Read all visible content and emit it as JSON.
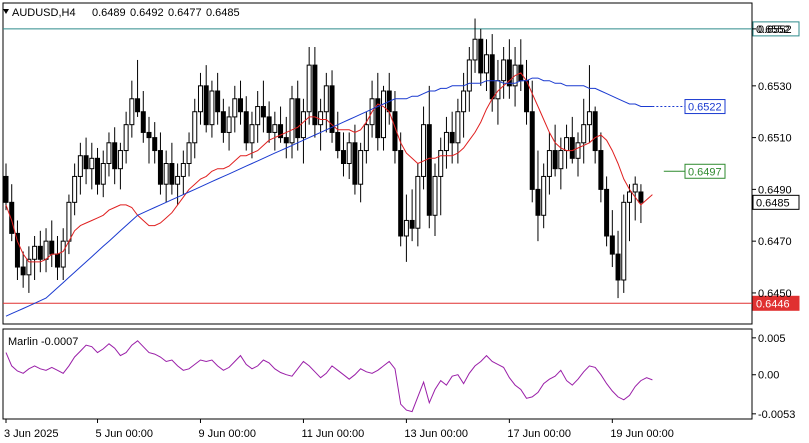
{
  "chart_data": {
    "type": "candlestick",
    "symbol_timeframe": "AUDUSD,H4",
    "ohlc_readout": [
      "0.6489",
      "0.6492",
      "0.6477",
      "0.6485"
    ],
    "ylim": [
      0.6438,
      0.6562
    ],
    "y_ticks": [
      "0.6552",
      "0.6530",
      "0.6510",
      "0.6490",
      "0.6470",
      "0.6450"
    ],
    "x_ticks": [
      "3 Jun 2025",
      "5 Jun 00:00",
      "9 Jun 00:00",
      "11 Jun 00:00",
      "13 Jun 00:00",
      "17 Jun 00:00",
      "19 Jun 00:00"
    ],
    "x_tick_index": [
      0,
      16,
      34,
      52,
      70,
      88,
      106
    ],
    "price_labels": [
      {
        "value": 0.6552,
        "text": "0.6552",
        "style": "teal-line"
      },
      {
        "value": 0.6522,
        "text": "0.6522",
        "style": "blue-box"
      },
      {
        "value": 0.6497,
        "text": "0.6497",
        "style": "green-box"
      },
      {
        "value": 0.6485,
        "text": "0.6485",
        "style": "current"
      },
      {
        "value": 0.6446,
        "text": "0.6446",
        "style": "red-line"
      }
    ],
    "level_lines": [
      {
        "value": 0.6552,
        "color": "#2e8b8b"
      },
      {
        "value": 0.6446,
        "color": "#e03030"
      }
    ],
    "resistance_level": {
      "value": 0.6497,
      "from_index": 115
    },
    "candles": [
      [
        0.6495,
        0.65,
        0.6482,
        0.6485
      ],
      [
        0.6485,
        0.6492,
        0.647,
        0.6473
      ],
      [
        0.6473,
        0.6478,
        0.6455,
        0.646
      ],
      [
        0.646,
        0.6466,
        0.6452,
        0.6457
      ],
      [
        0.6457,
        0.6468,
        0.645,
        0.6463
      ],
      [
        0.6463,
        0.6472,
        0.6455,
        0.6468
      ],
      [
        0.6468,
        0.6474,
        0.6458,
        0.6463
      ],
      [
        0.6463,
        0.6475,
        0.6458,
        0.647
      ],
      [
        0.647,
        0.6478,
        0.646,
        0.6465
      ],
      [
        0.6465,
        0.6472,
        0.6455,
        0.646
      ],
      [
        0.646,
        0.6475,
        0.6455,
        0.647
      ],
      [
        0.647,
        0.6488,
        0.6465,
        0.6485
      ],
      [
        0.6485,
        0.65,
        0.648,
        0.6495
      ],
      [
        0.6495,
        0.6508,
        0.6488,
        0.6503
      ],
      [
        0.6503,
        0.651,
        0.6492,
        0.6498
      ],
      [
        0.6498,
        0.6508,
        0.649,
        0.6502
      ],
      [
        0.6502,
        0.6506,
        0.6488,
        0.6492
      ],
      [
        0.6492,
        0.6505,
        0.6487,
        0.65
      ],
      [
        0.65,
        0.6512,
        0.6495,
        0.6508
      ],
      [
        0.6508,
        0.6514,
        0.6492,
        0.6498
      ],
      [
        0.6498,
        0.6508,
        0.649,
        0.6505
      ],
      [
        0.6505,
        0.652,
        0.65,
        0.6515
      ],
      [
        0.6515,
        0.6532,
        0.651,
        0.6525
      ],
      [
        0.6525,
        0.654,
        0.6518,
        0.652
      ],
      [
        0.652,
        0.6528,
        0.6508,
        0.6512
      ],
      [
        0.6512,
        0.6518,
        0.65,
        0.651
      ],
      [
        0.651,
        0.6516,
        0.65,
        0.6505
      ],
      [
        0.6505,
        0.6512,
        0.6488,
        0.6492
      ],
      [
        0.6492,
        0.6505,
        0.6485,
        0.65
      ],
      [
        0.65,
        0.6508,
        0.6488,
        0.6492
      ],
      [
        0.6492,
        0.65,
        0.6484,
        0.6495
      ],
      [
        0.6495,
        0.6505,
        0.6488,
        0.65
      ],
      [
        0.65,
        0.6512,
        0.6495,
        0.6508
      ],
      [
        0.6508,
        0.6525,
        0.6502,
        0.652
      ],
      [
        0.652,
        0.6535,
        0.6515,
        0.653
      ],
      [
        0.653,
        0.6538,
        0.6512,
        0.6515
      ],
      [
        0.6515,
        0.6532,
        0.651,
        0.6528
      ],
      [
        0.6528,
        0.6535,
        0.6515,
        0.652
      ],
      [
        0.652,
        0.6525,
        0.6508,
        0.6512
      ],
      [
        0.6512,
        0.6522,
        0.6505,
        0.6518
      ],
      [
        0.6518,
        0.653,
        0.6512,
        0.6525
      ],
      [
        0.6525,
        0.6532,
        0.6515,
        0.652
      ],
      [
        0.652,
        0.6526,
        0.6505,
        0.6508
      ],
      [
        0.6508,
        0.652,
        0.6502,
        0.6515
      ],
      [
        0.6515,
        0.6528,
        0.6508,
        0.6522
      ],
      [
        0.6522,
        0.6532,
        0.6512,
        0.6518
      ],
      [
        0.6518,
        0.6524,
        0.6508,
        0.6512
      ],
      [
        0.6512,
        0.652,
        0.6505,
        0.6515
      ],
      [
        0.6515,
        0.6522,
        0.6508,
        0.651
      ],
      [
        0.651,
        0.6518,
        0.6502,
        0.6508
      ],
      [
        0.6508,
        0.653,
        0.6502,
        0.6525
      ],
      [
        0.6525,
        0.6532,
        0.6505,
        0.651
      ],
      [
        0.651,
        0.6525,
        0.65,
        0.652
      ],
      [
        0.652,
        0.6545,
        0.6515,
        0.6538
      ],
      [
        0.6538,
        0.6545,
        0.651,
        0.6515
      ],
      [
        0.6515,
        0.6525,
        0.6505,
        0.652
      ],
      [
        0.652,
        0.6535,
        0.6512,
        0.653
      ],
      [
        0.653,
        0.6536,
        0.6508,
        0.6512
      ],
      [
        0.6512,
        0.652,
        0.6502,
        0.6505
      ],
      [
        0.6505,
        0.6512,
        0.6495,
        0.65
      ],
      [
        0.65,
        0.6512,
        0.6494,
        0.6508
      ],
      [
        0.6508,
        0.6515,
        0.6488,
        0.6492
      ],
      [
        0.6492,
        0.6508,
        0.6485,
        0.6505
      ],
      [
        0.6505,
        0.652,
        0.65,
        0.6515
      ],
      [
        0.6515,
        0.6532,
        0.651,
        0.6525
      ],
      [
        0.6525,
        0.6535,
        0.6505,
        0.651
      ],
      [
        0.651,
        0.653,
        0.6505,
        0.6528
      ],
      [
        0.6528,
        0.6535,
        0.6515,
        0.652
      ],
      [
        0.652,
        0.6528,
        0.65,
        0.6505
      ],
      [
        0.6505,
        0.6512,
        0.6468,
        0.6472
      ],
      [
        0.6472,
        0.6488,
        0.6462,
        0.6478
      ],
      [
        0.6478,
        0.649,
        0.647,
        0.6475
      ],
      [
        0.6475,
        0.65,
        0.6468,
        0.6495
      ],
      [
        0.6495,
        0.6522,
        0.649,
        0.6515
      ],
      [
        0.6515,
        0.653,
        0.6475,
        0.648
      ],
      [
        0.648,
        0.65,
        0.6472,
        0.6495
      ],
      [
        0.6495,
        0.651,
        0.648,
        0.6505
      ],
      [
        0.6505,
        0.6518,
        0.6498,
        0.6512
      ],
      [
        0.6512,
        0.652,
        0.65,
        0.6508
      ],
      [
        0.6508,
        0.6525,
        0.65,
        0.652
      ],
      [
        0.652,
        0.6535,
        0.651,
        0.6528
      ],
      [
        0.6528,
        0.6545,
        0.652,
        0.654
      ],
      [
        0.654,
        0.6556,
        0.6535,
        0.6548
      ],
      [
        0.6548,
        0.6552,
        0.653,
        0.6535
      ],
      [
        0.6535,
        0.6548,
        0.6528,
        0.6542
      ],
      [
        0.6542,
        0.655,
        0.652,
        0.6525
      ],
      [
        0.6525,
        0.654,
        0.6515,
        0.6532
      ],
      [
        0.6532,
        0.6545,
        0.6525,
        0.654
      ],
      [
        0.654,
        0.6548,
        0.6525,
        0.653
      ],
      [
        0.653,
        0.6545,
        0.6522,
        0.6538
      ],
      [
        0.6538,
        0.6548,
        0.6528,
        0.6532
      ],
      [
        0.6532,
        0.654,
        0.6515,
        0.652
      ],
      [
        0.652,
        0.6532,
        0.6485,
        0.649
      ],
      [
        0.649,
        0.6505,
        0.647,
        0.648
      ],
      [
        0.648,
        0.65,
        0.6475,
        0.6495
      ],
      [
        0.6495,
        0.6512,
        0.6488,
        0.6505
      ],
      [
        0.6505,
        0.6515,
        0.6495,
        0.6498
      ],
      [
        0.6498,
        0.651,
        0.649,
        0.6505
      ],
      [
        0.6505,
        0.6515,
        0.6498,
        0.651
      ],
      [
        0.651,
        0.6518,
        0.65,
        0.6502
      ],
      [
        0.6502,
        0.6512,
        0.6495,
        0.6508
      ],
      [
        0.6508,
        0.6525,
        0.65,
        0.6515
      ],
      [
        0.6515,
        0.6538,
        0.6508,
        0.652
      ],
      [
        0.652,
        0.6522,
        0.65,
        0.6505
      ],
      [
        0.6505,
        0.6512,
        0.6485,
        0.649
      ],
      [
        0.649,
        0.6495,
        0.6468,
        0.6472
      ],
      [
        0.6472,
        0.6482,
        0.646,
        0.6465
      ],
      [
        0.6465,
        0.6474,
        0.6448,
        0.6455
      ],
      [
        0.6455,
        0.6488,
        0.645,
        0.6485
      ],
      [
        0.6485,
        0.6492,
        0.647,
        0.6489
      ],
      [
        0.6489,
        0.6495,
        0.6478,
        0.6492
      ],
      [
        0.6489,
        0.6492,
        0.6477,
        0.6485
      ]
    ],
    "moving_averages": [
      {
        "color": "#e02020",
        "values": [
          0.6484,
          0.6478,
          0.647,
          0.6465,
          0.6462,
          0.6462,
          0.6462,
          0.6463,
          0.6465,
          0.6465,
          0.6466,
          0.647,
          0.6474,
          0.6476,
          0.6477,
          0.6478,
          0.6479,
          0.648,
          0.6482,
          0.6483,
          0.6484,
          0.6484,
          0.6483,
          0.648,
          0.6478,
          0.6476,
          0.6476,
          0.6477,
          0.6479,
          0.6481,
          0.6484,
          0.6487,
          0.649,
          0.6492,
          0.6494,
          0.6495,
          0.6497,
          0.6498,
          0.6498,
          0.6499,
          0.6501,
          0.6503,
          0.6503,
          0.6504,
          0.6505,
          0.6507,
          0.6509,
          0.651,
          0.6511,
          0.6512,
          0.6513,
          0.6514,
          0.6516,
          0.6518,
          0.6518,
          0.6517,
          0.6517,
          0.6515,
          0.6513,
          0.6513,
          0.6513,
          0.6512,
          0.6513,
          0.6516,
          0.652,
          0.6523,
          0.6522,
          0.652,
          0.6514,
          0.6508,
          0.6504,
          0.6502,
          0.65,
          0.6501,
          0.6502,
          0.6502,
          0.6503,
          0.6503,
          0.6503,
          0.6504,
          0.6506,
          0.6509,
          0.6512,
          0.6516,
          0.6521,
          0.6525,
          0.6528,
          0.653,
          0.6532,
          0.6534,
          0.6535,
          0.6532,
          0.6527,
          0.6522,
          0.6517,
          0.6512,
          0.6508,
          0.6506,
          0.6505,
          0.6505,
          0.6506,
          0.6507,
          0.6508,
          0.651,
          0.6511,
          0.6509,
          0.6505,
          0.65,
          0.6494,
          0.649,
          0.6487,
          0.6484,
          0.6486,
          0.6488
        ]
      },
      {
        "color": "#1a3ad0",
        "values": [
          0.6441,
          0.6442,
          0.6443,
          0.6444,
          0.6445,
          0.6446,
          0.6447,
          0.6448,
          0.645,
          0.6452,
          0.6454,
          0.6456,
          0.6458,
          0.646,
          0.6462,
          0.6464,
          0.6466,
          0.6468,
          0.647,
          0.6472,
          0.6474,
          0.6476,
          0.6478,
          0.648,
          0.6481,
          0.6482,
          0.6483,
          0.6484,
          0.6485,
          0.6486,
          0.6487,
          0.6488,
          0.6489,
          0.649,
          0.6491,
          0.6492,
          0.6493,
          0.6494,
          0.6495,
          0.6496,
          0.6497,
          0.6498,
          0.6499,
          0.65,
          0.6501,
          0.6502,
          0.6503,
          0.6504,
          0.6505,
          0.6506,
          0.6507,
          0.6508,
          0.6509,
          0.651,
          0.6511,
          0.6512,
          0.6513,
          0.6514,
          0.6515,
          0.6516,
          0.6517,
          0.6518,
          0.6519,
          0.652,
          0.6521,
          0.6522,
          0.6523,
          0.6524,
          0.6525,
          0.6525,
          0.6525,
          0.6526,
          0.6526,
          0.6527,
          0.6528,
          0.6528,
          0.6529,
          0.6529,
          0.653,
          0.653,
          0.653,
          0.6531,
          0.6531,
          0.6531,
          0.6532,
          0.6532,
          0.6532,
          0.6531,
          0.6531,
          0.6531,
          0.6532,
          0.6532,
          0.6533,
          0.6533,
          0.6532,
          0.6532,
          0.6531,
          0.6531,
          0.653,
          0.653,
          0.653,
          0.653,
          0.6529,
          0.6529,
          0.6528,
          0.6527,
          0.6526,
          0.6525,
          0.6524,
          0.6523,
          0.6523,
          0.6522,
          0.6522,
          0.6522
        ]
      }
    ],
    "ma_projection_end": 0.6522,
    "oscillator": {
      "label": "Marlin -0.0007",
      "ylim": [
        -0.006,
        0.0062
      ],
      "ticks": [
        "0.005",
        "0.00",
        "-0.0053"
      ],
      "tick_values": [
        0.005,
        0.0,
        -0.0053
      ],
      "values": [
        0.003,
        0.0012,
        0.0005,
        0.0002,
        0.0008,
        0.0012,
        0.0008,
        0.0006,
        0.001,
        0.0006,
        0.0002,
        0.0012,
        0.0024,
        0.0032,
        0.004,
        0.0038,
        0.003,
        0.0035,
        0.0042,
        0.0036,
        0.0026,
        0.003,
        0.004,
        0.0046,
        0.0038,
        0.003,
        0.0028,
        0.0024,
        0.0018,
        0.002,
        0.0012,
        0.0006,
        0.0008,
        0.0014,
        0.002,
        0.0018,
        0.002,
        0.0012,
        0.0006,
        0.001,
        0.0018,
        0.0026,
        0.0014,
        0.0008,
        0.0012,
        0.002,
        0.0016,
        0.0008,
        0.0003,
        0.0,
        -0.0002,
        0.0008,
        0.0018,
        0.0012,
        0.0004,
        -0.0004,
        0.0002,
        0.0012,
        0.0006,
        0.0,
        -0.0006,
        0.0,
        0.0008,
        0.0004,
        0.0002,
        0.0006,
        0.0012,
        0.0018,
        0.0008,
        -0.004,
        -0.0048,
        -0.005,
        -0.003,
        -0.001,
        -0.0038,
        -0.002,
        -0.0008,
        -0.0014,
        -0.0002,
        0.0,
        -0.0012,
        0.0002,
        0.0012,
        0.0018,
        0.0026,
        0.0018,
        0.0014,
        0.001,
        -0.0004,
        -0.0014,
        -0.002,
        -0.0032,
        -0.003,
        -0.0024,
        -0.0012,
        -0.0006,
        -0.0002,
        0.0006,
        -0.0008,
        -0.0014,
        -0.0006,
        0.0004,
        0.0012,
        0.001,
        0.0,
        -0.0012,
        -0.0022,
        -0.003,
        -0.0034,
        -0.0028,
        -0.0016,
        -0.0008,
        -0.0004,
        -0.0007
      ]
    }
  }
}
